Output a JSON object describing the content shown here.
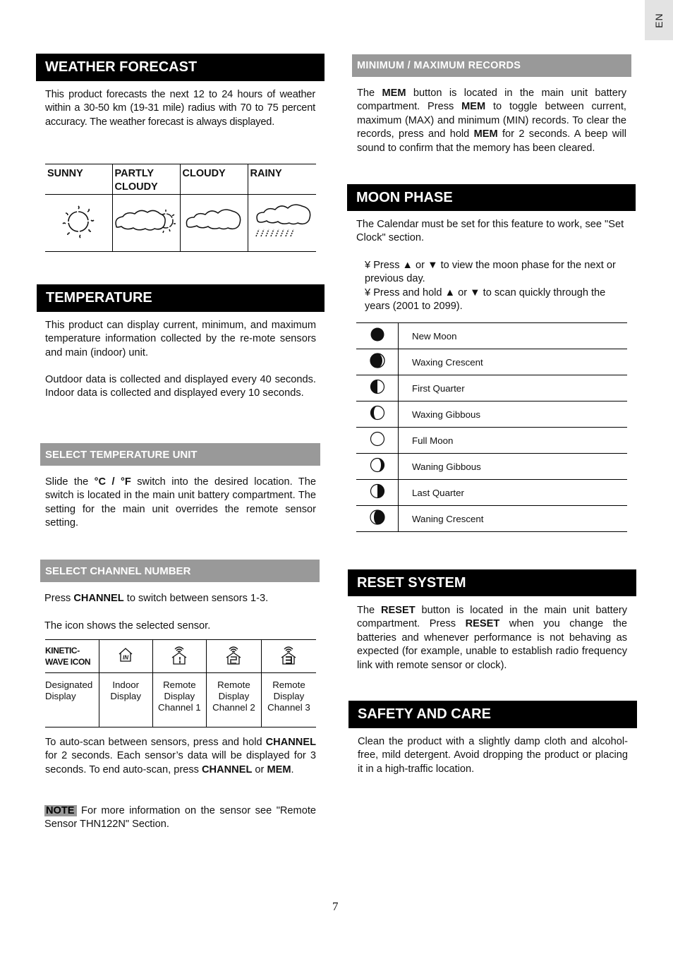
{
  "language_tab": "EN",
  "page_number": "7",
  "weather_forecast": {
    "title": "WEATHER FORECAST",
    "body": "This product forecasts the next 12 to 24 hours of weather within a 30-50 km (19-31 mile) radius with 70 to 75 percent accuracy. The weather forecast is always displayed.",
    "table": [
      {
        "label": "SUNNY",
        "icon": "sun-icon"
      },
      {
        "label": "PARTLY CLOUDY",
        "icon": "partly-cloudy-icon"
      },
      {
        "label": "CLOUDY",
        "icon": "cloudy-icon"
      },
      {
        "label": "RAINY",
        "icon": "rainy-icon"
      }
    ]
  },
  "temperature": {
    "title": "TEMPERATURE",
    "body1": "This product can display current, minimum, and maximum temperature information collected by the re-mote sensors and main (indoor) unit.",
    "body2": "Outdoor data is collected and displayed every 40 seconds. Indoor data is collected and displayed every 10 seconds."
  },
  "select_unit": {
    "title": "SELECT TEMPERATURE UNIT",
    "pre": "Slide the ",
    "bold": "°C / °F",
    "post": " switch into the desired location. The switch is located in the main unit battery compartment. The setting for the main unit overrides the remote sensor setting."
  },
  "select_channel": {
    "title": "SELECT CHANNEL NUMBER",
    "line1_pre": "Press ",
    "line1_bold": "CHANNEL",
    "line1_post": " to switch between sensors 1-3.",
    "line2": "The icon shows the selected sensor.",
    "table": {
      "header_label": "KINETIC-WAVE ICON",
      "row_label": "Designated Display",
      "columns": [
        {
          "icon": "indoor-house-icon",
          "icon_text": "IN",
          "label": "Indoor Display"
        },
        {
          "icon": "remote-channel-1-icon",
          "icon_text": "1",
          "label": "Remote Display Channel 1"
        },
        {
          "icon": "remote-channel-2-icon",
          "icon_text": "2",
          "label": "Remote Display Channel 2"
        },
        {
          "icon": "remote-channel-3-icon",
          "icon_text": "3",
          "label": "Remote Display Channel 3"
        }
      ]
    },
    "autoscan": {
      "p1": "To auto-scan between sensors, press and hold ",
      "b1": "CHANNEL",
      "p2": " for 2 seconds. Each sensor’s data will be displayed for 3 seconds. To end auto-scan, press ",
      "b2": "CHANNEL",
      "p3": " or ",
      "b3": "MEM",
      "p4": "."
    },
    "note_label": "NOTE",
    "note_text": " For more information on the sensor see \"Remote Sensor THN122N\" Section."
  },
  "min_max": {
    "title": "MINIMUM / MAXIMUM RECORDS",
    "p1": "The ",
    "b1": "MEM",
    "p2": " button is located in the main unit battery compartment. Press ",
    "b2": "MEM",
    "p3": " to toggle between current, maximum (MAX) and minimum (MIN) records. To clear the records, press and hold ",
    "b3": "MEM",
    "p4": " for 2 seconds. A beep will sound to confirm that the memory has been cleared."
  },
  "moon_phase": {
    "title": "MOON PHASE",
    "body": "The Calendar must be set for this feature to work, see \"Set Clock\" section.",
    "bullets": [
      {
        "mark": "¥",
        "pre": "Press ",
        "mid": " or ",
        "post": " to view the moon phase for the next or previous day."
      },
      {
        "mark": "¥",
        "pre": "Press and hold ",
        "mid": " or ",
        "post": " to scan quickly through the years (2001 to 2099)."
      }
    ],
    "up_arrow": "▲",
    "down_arrow": "▼",
    "phases": [
      {
        "name": "New Moon",
        "icon": "new-moon-icon"
      },
      {
        "name": "Waxing Crescent",
        "icon": "waxing-crescent-icon"
      },
      {
        "name": "First Quarter",
        "icon": "first-quarter-icon"
      },
      {
        "name": "Waxing Gibbous",
        "icon": "waxing-gibbous-icon"
      },
      {
        "name": "Full Moon",
        "icon": "full-moon-icon"
      },
      {
        "name": "Waning Gibbous",
        "icon": "waning-gibbous-icon"
      },
      {
        "name": "Last Quarter",
        "icon": "last-quarter-icon"
      },
      {
        "name": "Waning Crescent",
        "icon": "waning-crescent-icon"
      }
    ]
  },
  "reset_system": {
    "title": "RESET SYSTEM",
    "p1": "The ",
    "b1": "RESET",
    "p2": " button is located in the main unit battery compartment. Press ",
    "b2": "RESET",
    "p3": " when you change the batteries and whenever performance is not behaving as expected (for example, unable to establish radio frequency link with remote sensor or clock)."
  },
  "safety_care": {
    "title": "SAFETY AND CARE",
    "body": "Clean the product with a slightly damp cloth and alcohol-free, mild detergent. Avoid dropping the product or placing it in a high-traffic location."
  }
}
